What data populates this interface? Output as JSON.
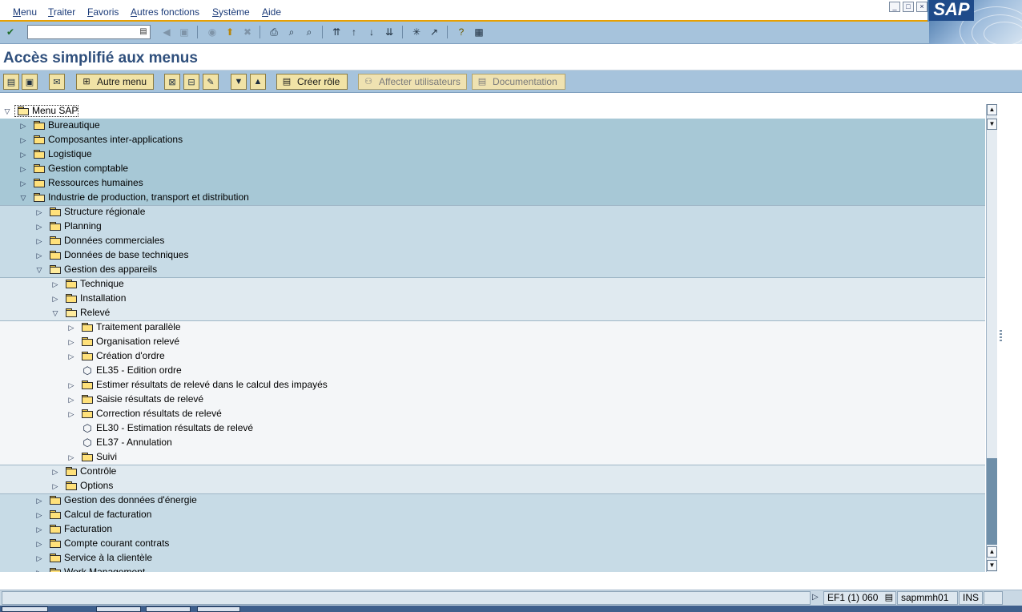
{
  "menubar": {
    "items": [
      "Menu",
      "Traiter",
      "Favoris",
      "Autres fonctions",
      "Système",
      "Aide"
    ],
    "logo_text": "SAP"
  },
  "command_field": {
    "value": ""
  },
  "title": "Accès simplifié aux menus",
  "app_toolbar": {
    "other_menu": "Autre menu",
    "create_role": "Créer rôle",
    "assign_users": "Affecter utilisateurs",
    "documentation": "Documentation"
  },
  "tree": [
    {
      "label": "Menu SAP",
      "level": 0,
      "type": "root"
    },
    {
      "label": "Bureautique",
      "level": 1,
      "type": "folder"
    },
    {
      "label": "Composantes inter-applications",
      "level": 1,
      "type": "folder"
    },
    {
      "label": "Logistique",
      "level": 1,
      "type": "folder"
    },
    {
      "label": "Gestion comptable",
      "level": 1,
      "type": "folder"
    },
    {
      "label": "Ressources humaines",
      "level": 1,
      "type": "folder"
    },
    {
      "label": "Industrie de production, transport et distribution",
      "level": 1,
      "type": "open"
    },
    {
      "label": "Structure régionale",
      "level": 2,
      "type": "folder"
    },
    {
      "label": "Planning",
      "level": 2,
      "type": "folder"
    },
    {
      "label": "Données commerciales",
      "level": 2,
      "type": "folder"
    },
    {
      "label": "Données de base techniques",
      "level": 2,
      "type": "folder"
    },
    {
      "label": "Gestion des appareils",
      "level": 2,
      "type": "open"
    },
    {
      "label": "Technique",
      "level": 3,
      "type": "folder"
    },
    {
      "label": "Installation",
      "level": 3,
      "type": "folder"
    },
    {
      "label": "Relevé",
      "level": 3,
      "type": "open"
    },
    {
      "label": "Traitement parallèle",
      "level": 4,
      "type": "folder"
    },
    {
      "label": "Organisation relevé",
      "level": 4,
      "type": "folder"
    },
    {
      "label": "Création d'ordre",
      "level": 4,
      "type": "folder"
    },
    {
      "label": "EL35 - Edition ordre",
      "level": 4,
      "type": "transaction"
    },
    {
      "label": "Estimer résultats de relevé dans le calcul des impayés",
      "level": 4,
      "type": "folder"
    },
    {
      "label": "Saisie résultats de relevé",
      "level": 4,
      "type": "folder"
    },
    {
      "label": "Correction résultats de relevé",
      "level": 4,
      "type": "folder"
    },
    {
      "label": "EL30 - Estimation résultats de relevé",
      "level": 4,
      "type": "transaction"
    },
    {
      "label": "EL37 - Annulation",
      "level": 4,
      "type": "transaction"
    },
    {
      "label": "Suivi",
      "level": 4,
      "type": "folder"
    },
    {
      "label": "Contrôle",
      "level": 3,
      "type": "folder"
    },
    {
      "label": "Options",
      "level": 3,
      "type": "folder"
    },
    {
      "label": "Gestion des données d'énergie",
      "level": 2,
      "type": "folder"
    },
    {
      "label": "Calcul de facturation",
      "level": 2,
      "type": "folder"
    },
    {
      "label": "Facturation",
      "level": 2,
      "type": "folder"
    },
    {
      "label": "Compte courant contrats",
      "level": 2,
      "type": "folder"
    },
    {
      "label": "Service à la clientèle",
      "level": 2,
      "type": "folder"
    },
    {
      "label": "Work Management",
      "level": 2,
      "type": "folder"
    }
  ],
  "status": {
    "system": "EF1 (1) 060",
    "program": "sapmmh01",
    "mode": "INS"
  }
}
